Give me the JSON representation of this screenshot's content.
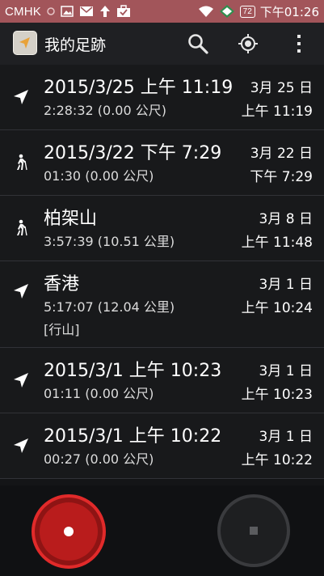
{
  "status_bar": {
    "carrier": "CMHK",
    "battery": "72",
    "time": "下午01:26",
    "icons": [
      "circle-icon",
      "image-icon",
      "mail-icon",
      "upload-arrow-icon",
      "briefcase-check-icon",
      "wifi-icon",
      "signal-icon",
      "battery-icon"
    ]
  },
  "action_bar": {
    "title": "我的足跡",
    "icons": [
      "app-navigation-icon",
      "search-icon",
      "gps-locate-icon",
      "overflow-menu-icon"
    ]
  },
  "tracks": [
    {
      "icon": "navigation-arrow-icon",
      "title": "2015/3/25 上午 11:19",
      "subtitle": "2:28:32 (0.00 公尺)",
      "tag": "",
      "date": "3月 25 日",
      "time": "上午 11:19"
    },
    {
      "icon": "hiking-icon",
      "title": "2015/3/22 下午 7:29",
      "subtitle": "01:30 (0.00 公尺)",
      "tag": "",
      "date": "3月 22 日",
      "time": "下午 7:29"
    },
    {
      "icon": "hiking-icon",
      "title": "柏架山",
      "subtitle": "3:57:39 (10.51 公里)",
      "tag": "",
      "date": "3月 8 日",
      "time": "上午 11:48"
    },
    {
      "icon": "navigation-arrow-icon",
      "title": "香港",
      "subtitle": "5:17:07 (12.04 公里)",
      "tag": "[行山]",
      "date": "3月 1 日",
      "time": "上午 10:24"
    },
    {
      "icon": "navigation-arrow-icon",
      "title": "2015/3/1 上午 10:23",
      "subtitle": "01:11 (0.00 公尺)",
      "tag": "",
      "date": "3月 1 日",
      "time": "上午 10:23"
    },
    {
      "icon": "navigation-arrow-icon",
      "title": "2015/3/1 上午 10:22",
      "subtitle": "00:27 (0.00 公尺)",
      "tag": "",
      "date": "3月 1 日",
      "time": "上午 10:22"
    }
  ],
  "controls": {
    "record_icon": "record-icon",
    "stop_icon": "stop-icon",
    "colors": {
      "record": "#b91c1c",
      "record_ring": "#e12a2a",
      "stop": "#3a3b3e"
    }
  },
  "colors": {
    "status_bar": "#a2555a",
    "action_bar": "#1f2023",
    "list_bg": "#18191b",
    "divider": "#313237"
  }
}
